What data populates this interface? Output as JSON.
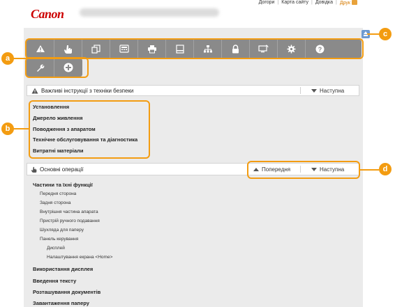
{
  "header": {
    "logo": "Canon",
    "links": [
      "Догори",
      "Карта сайту",
      "Довідка"
    ],
    "print_label": "Друк"
  },
  "callouts": [
    "a",
    "b",
    "c",
    "d"
  ],
  "toolbar": {
    "icons_row1": [
      "warning-icon",
      "hand-icon",
      "copy-icon",
      "fax-icon",
      "printer-icon",
      "scanner-icon",
      "network-icon",
      "lock-icon",
      "remote-ui-icon",
      "settings-icon",
      "help-icon"
    ],
    "icons_row2": [
      "wrench-icon",
      "plus-icon"
    ]
  },
  "safety_section": {
    "title": "Важливі інструкції з техніки безпеки",
    "next": "Наступна",
    "items": [
      "Установлення",
      "Джерело живлення",
      "Поводження з апаратом",
      "Технічне обслуговування та діагностика",
      "Витратні матеріали"
    ]
  },
  "basic_section": {
    "title": "Основні операції",
    "prev": "Попередня",
    "next": "Наступна",
    "parts_heading": "Частини та їхні функції",
    "parts": [
      "Передня сторона",
      "Задня сторона",
      "Внутрішня частина апарата",
      "Пристрій ручного подавання",
      "Шухляда для паперу",
      "Панель керування"
    ],
    "panel_sub": [
      "Дисплей",
      "Налаштування екрана <Home>"
    ],
    "more": [
      "Використання дисплея",
      "Введення тексту",
      "Розташування документів",
      "Завантаження паперу"
    ]
  }
}
